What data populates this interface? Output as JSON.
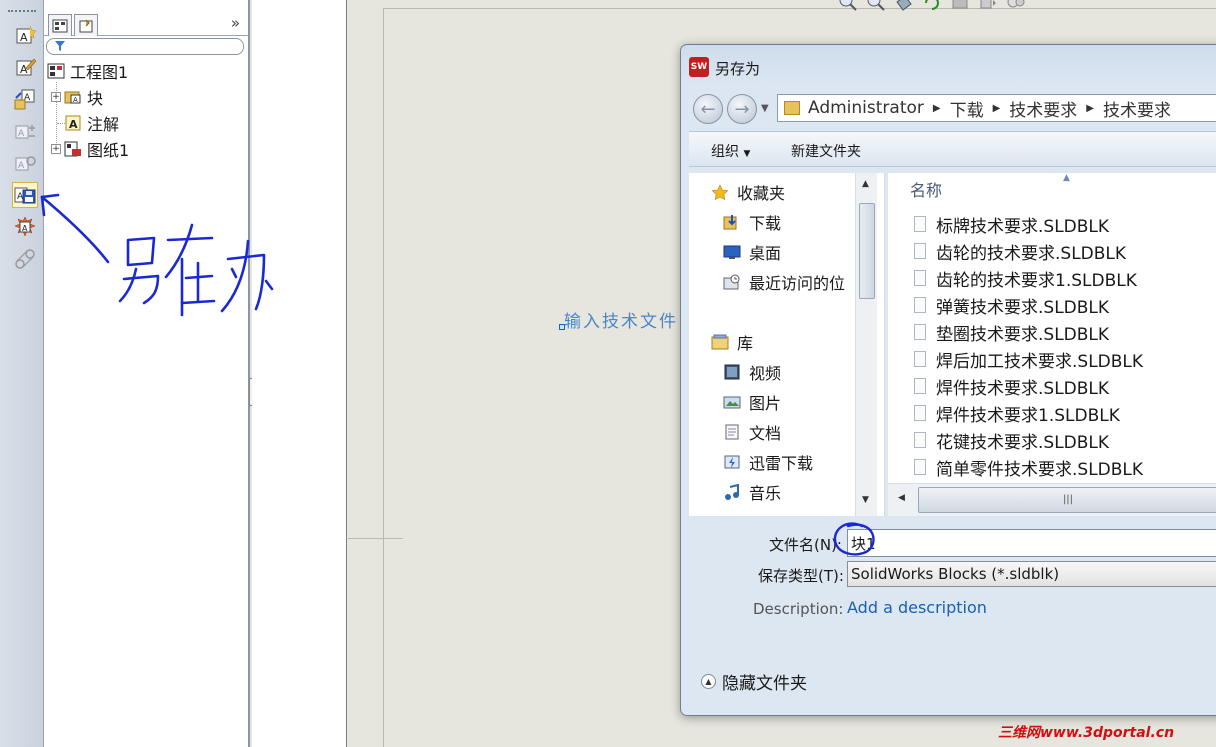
{
  "feature_tree": {
    "root": "工程图1",
    "children": [
      "块",
      "注解",
      "图纸1"
    ]
  },
  "annotation": {
    "handwriting": "另存为"
  },
  "drawing": {
    "note": "输入技术文件"
  },
  "dialog": {
    "title": "另存为",
    "app_badge": "SW",
    "breadcrumb": [
      "Administrator",
      "下载",
      "技术要求",
      "技术要求"
    ],
    "toolbar": {
      "organize": "组织",
      "new_folder": "新建文件夹"
    },
    "nav_items": [
      {
        "label": "收藏夹",
        "icon": "star-icon",
        "level": 0
      },
      {
        "label": "下载",
        "icon": "download-folder-icon",
        "level": 1
      },
      {
        "label": "桌面",
        "icon": "desktop-icon",
        "level": 1
      },
      {
        "label": "最近访问的位",
        "icon": "recent-places-icon",
        "level": 1
      },
      {
        "label": "库",
        "icon": "library-icon",
        "level": 0
      },
      {
        "label": "视频",
        "icon": "video-library-icon",
        "level": 1
      },
      {
        "label": "图片",
        "icon": "pictures-library-icon",
        "level": 1
      },
      {
        "label": "文档",
        "icon": "documents-library-icon",
        "level": 1
      },
      {
        "label": "迅雷下载",
        "icon": "thunder-download-icon",
        "level": 1
      },
      {
        "label": "音乐",
        "icon": "music-library-icon",
        "level": 1
      }
    ],
    "column_name": "名称",
    "files": [
      "标牌技术要求.SLDBLK",
      "齿轮的技术要求.SLDBLK",
      "齿轮的技术要求1.SLDBLK",
      "弹簧技术要求.SLDBLK",
      "垫圈技术要求.SLDBLK",
      "焊后加工技术要求.SLDBLK",
      "焊件技术要求.SLDBLK",
      "焊件技术要求1.SLDBLK",
      "花键技术要求.SLDBLK",
      "简单零件技术要求.SLDBLK"
    ],
    "filename_label": "文件名(N):",
    "filename_value": "块1",
    "filetype_label": "保存类型(T):",
    "filetype_value": "SolidWorks Blocks (*.sldblk)",
    "description_label": "Description:",
    "description_link": "Add a description",
    "hide_folders": "隐藏文件夹"
  },
  "watermark": "三维网www.3dportal.cn",
  "colors": {
    "accent_blue": "#1a5fb4",
    "handwriting_ink": "#1a2ad0",
    "watermark_red": "#d01010"
  }
}
